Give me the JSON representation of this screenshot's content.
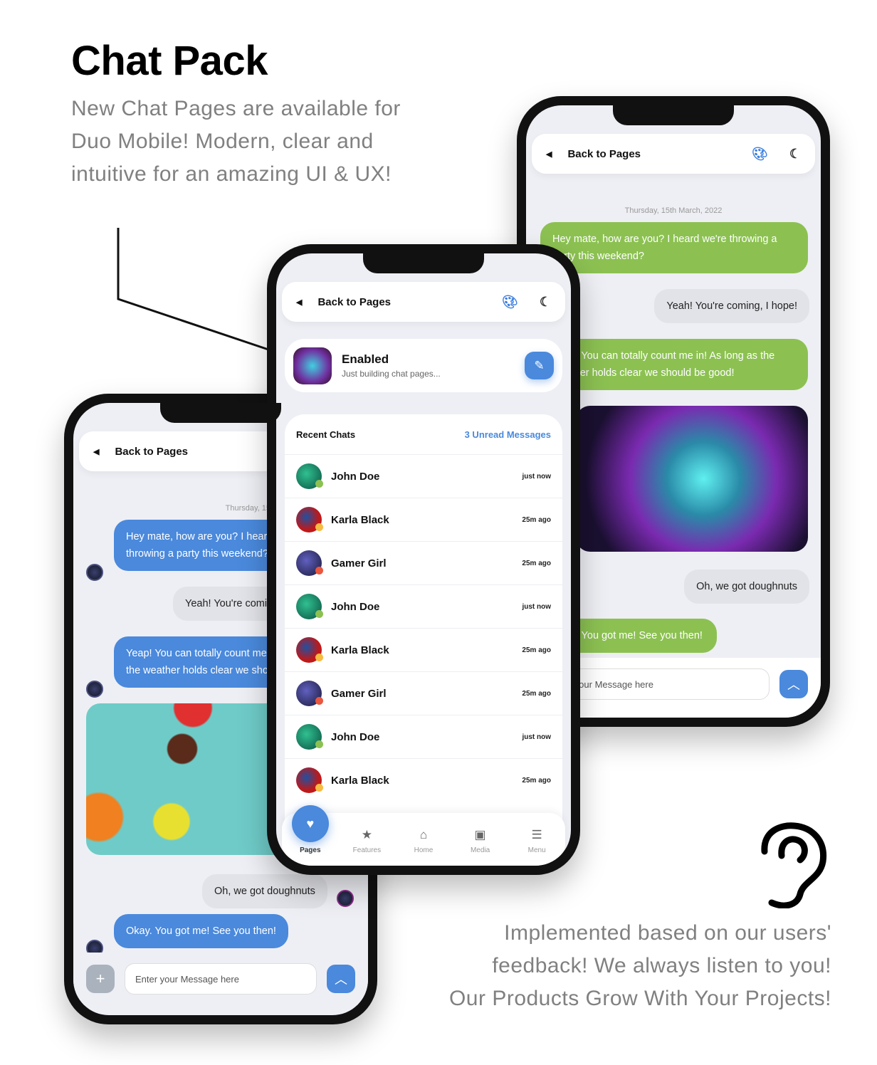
{
  "promo": {
    "title": "Chat Pack",
    "subtitle": "New Chat Pages are available for Duo Mobile! Modern, clear and intuitive for an amazing UI & UX!",
    "footer_lines": [
      "Implemented based on our users'",
      "feedback! We always listen to you!",
      "Our Products Grow With Your Projects!"
    ]
  },
  "header": {
    "back_label": "Back to Pages",
    "back_icon": "caret-left",
    "palette_icon": "palette",
    "theme_icon": "moon"
  },
  "colors": {
    "accent": "#4a89dc",
    "green": "#8cc152",
    "online": "#8cc152",
    "busy": "#e9573f",
    "away": "#f6bb42"
  },
  "chat": {
    "date": "Thursday, 15th March, 2022",
    "input_placeholder": "Enter your Message here",
    "messages": [
      {
        "text": "Hey mate, how are you? I heard we're throwing a party this weekend?",
        "side": "sent"
      },
      {
        "text": "Yeah! You're coming, I hope!",
        "side": "received"
      },
      {
        "text": "Yeap! You can totally count me in! As long as the weather holds clear we should be good!",
        "side": "sent"
      },
      {
        "text": "Oh, we got doughnuts",
        "side": "received"
      },
      {
        "text": "Okay. You got me! See you then!",
        "side": "sent"
      }
    ]
  },
  "profile": {
    "status": "Enabled",
    "tagline": "Just building chat pages...",
    "edit_icon": "edit"
  },
  "recent": {
    "title": "Recent Chats",
    "unread": "3 Unread Messages",
    "items": [
      {
        "name": "John Doe",
        "time": "just now",
        "status": "online"
      },
      {
        "name": "Karla Black",
        "time": "25m ago",
        "status": "away"
      },
      {
        "name": "Gamer Girl",
        "time": "25m ago",
        "status": "busy"
      },
      {
        "name": "John Doe",
        "time": "just now",
        "status": "online"
      },
      {
        "name": "Karla Black",
        "time": "25m ago",
        "status": "away"
      },
      {
        "name": "Gamer Girl",
        "time": "25m ago",
        "status": "busy"
      },
      {
        "name": "John Doe",
        "time": "just now",
        "status": "online"
      },
      {
        "name": "Karla Black",
        "time": "25m ago",
        "status": "away"
      }
    ]
  },
  "nav": [
    {
      "label": "Pages",
      "icon": "heart",
      "active": true
    },
    {
      "label": "Features",
      "icon": "star"
    },
    {
      "label": "Home",
      "icon": "home"
    },
    {
      "label": "Media",
      "icon": "image"
    },
    {
      "label": "Menu",
      "icon": "menu"
    }
  ]
}
